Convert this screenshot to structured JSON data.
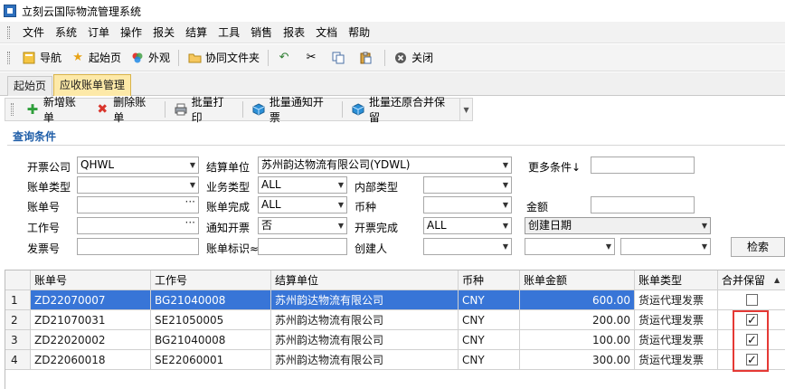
{
  "window": {
    "title": "立刻云国际物流管理系统"
  },
  "menu": [
    "文件",
    "系统",
    "订单",
    "操作",
    "报关",
    "结算",
    "工具",
    "销售",
    "报表",
    "文档",
    "帮助"
  ],
  "toolbar": {
    "nav": "导航",
    "start": "起始页",
    "appearance": "外观",
    "shared_folder": "协同文件夹",
    "close": "关闭"
  },
  "tabs": [
    "起始页",
    "应收账单管理"
  ],
  "actions": {
    "add": "新增账单",
    "delete": "删除账单",
    "batch_print": "批量打印",
    "batch_invoice": "批量通知开票",
    "batch_restore": "批量还原合并保留"
  },
  "query": {
    "title": "查询条件",
    "invoice_company_label": "开票公司",
    "invoice_company_value": "QHWL",
    "settle_unit_label": "结算单位",
    "settle_unit_value": "苏州韵达物流有限公司(YDWL)",
    "more_conditions": "更多条件↓",
    "bill_type_label": "账单类型",
    "biz_type_label": "业务类型",
    "biz_type_value": "ALL",
    "internal_type_label": "内部类型",
    "bill_no_label": "账单号",
    "bill_done_label": "账单完成",
    "bill_done_value": "ALL",
    "currency_label": "币种",
    "amount_label": "金额",
    "work_no_label": "工作号",
    "notify_invoice_label": "通知开票",
    "notify_invoice_value": "否",
    "invoice_done_label": "开票完成",
    "invoice_done_value": "ALL",
    "created_date_value": "创建日期",
    "invoice_no_label": "发票号",
    "bill_mark_label": "账单标识≈",
    "creator_label": "创建人",
    "search": "检索"
  },
  "grid": {
    "columns": [
      "账单号",
      "工作号",
      "结算单位",
      "币种",
      "账单金额",
      "账单类型",
      "合并保留"
    ],
    "rows": [
      {
        "n": "1",
        "bill_no": "ZD22070007",
        "work_no": "BG21040008",
        "unit": "苏州韵达物流有限公司",
        "currency": "CNY",
        "amount": "600.00",
        "type": "货运代理发票",
        "merge": false
      },
      {
        "n": "2",
        "bill_no": "ZD21070031",
        "work_no": "SE21050005",
        "unit": "苏州韵达物流有限公司",
        "currency": "CNY",
        "amount": "200.00",
        "type": "货运代理发票",
        "merge": true
      },
      {
        "n": "3",
        "bill_no": "ZD22020002",
        "work_no": "BG21040008",
        "unit": "苏州韵达物流有限公司",
        "currency": "CNY",
        "amount": "100.00",
        "type": "货运代理发票",
        "merge": true
      },
      {
        "n": "4",
        "bill_no": "ZD22060018",
        "work_no": "SE22060001",
        "unit": "苏州韵达物流有限公司",
        "currency": "CNY",
        "amount": "300.00",
        "type": "货运代理发票",
        "merge": true
      }
    ]
  }
}
